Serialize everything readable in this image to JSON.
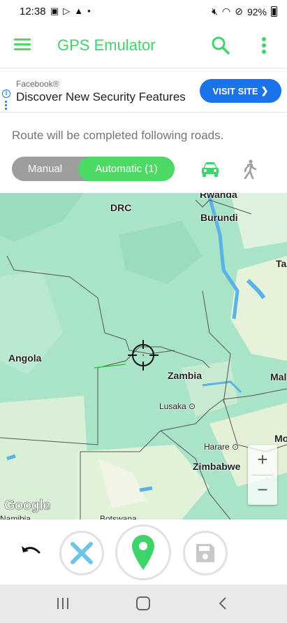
{
  "status_bar": {
    "time": "12:38",
    "battery": "92%",
    "left_icons": [
      "gallery-icon",
      "play-store-icon",
      "warning-icon",
      "dot-icon"
    ],
    "right_icons": [
      "mute-icon",
      "wifi-icon",
      "no-disturb-icon",
      "battery-icon"
    ]
  },
  "app_bar": {
    "title": "GPS Emulator",
    "title_color": "#3fd46a"
  },
  "ad": {
    "sponsor": "Facebook®",
    "headline": "Discover New Security Features",
    "button_label": "VISIT SITE",
    "button_color": "#1a73e8"
  },
  "route": {
    "info_text": "Route will be completed following roads.",
    "mode_manual": "Manual",
    "mode_automatic": "Automatic (1)",
    "active_mode": "Automatic (1)",
    "accent_color": "#4cd964",
    "transport_options": [
      "car-icon",
      "walk-icon"
    ],
    "selected_transport": "car-icon"
  },
  "map": {
    "labels": {
      "rwanda": "Rwanda",
      "drc": "DRC",
      "burundi": "Burundi",
      "ta": "Ta",
      "angola": "Angola",
      "zambia": "Zambia",
      "mal": "Mal",
      "lusaka": "Lusaka",
      "mo": "Mo",
      "harare": "Harare",
      "zimbabwe": "Zimbabwe",
      "namibia": "Namibia",
      "botswana": "Botswana"
    },
    "zoom_in": "+",
    "zoom_out": "−",
    "attribution": "Google"
  },
  "bottom_bar": {
    "actions": [
      "undo-icon",
      "clear-route-icon",
      "add-pin-icon",
      "save-icon"
    ]
  }
}
